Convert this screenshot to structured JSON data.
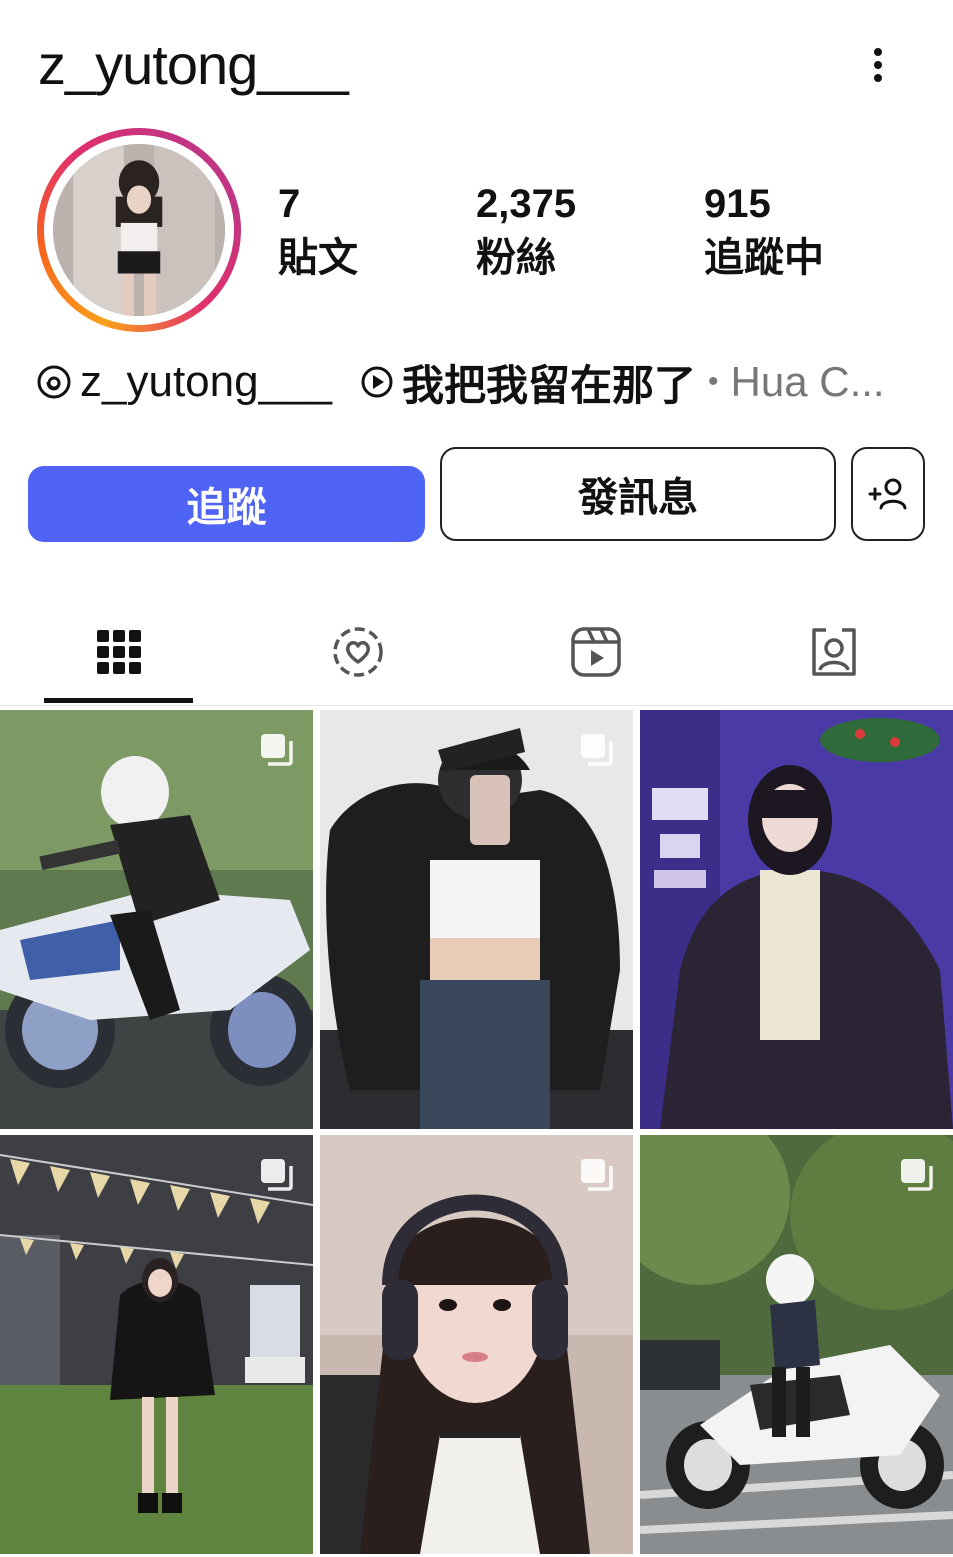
{
  "profile": {
    "username": "z_yutong___",
    "stats": [
      {
        "value": "7",
        "label": "貼文"
      },
      {
        "value": "2,375",
        "label": "粉絲"
      },
      {
        "value": "915",
        "label": "追蹤中"
      }
    ],
    "threads_handle": "z_yutong___",
    "song_title": "我把我留在那了",
    "song_separator": "•",
    "song_artist": "Hua C..."
  },
  "actions": {
    "follow_label": "追蹤",
    "message_label": "發訊息",
    "add_user_icon": "add-user-icon"
  },
  "tabs": [
    {
      "icon": "grid-icon",
      "active": true
    },
    {
      "icon": "highlights-heart-icon",
      "active": false
    },
    {
      "icon": "reels-icon",
      "active": false
    },
    {
      "icon": "tagged-icon",
      "active": false
    }
  ],
  "posts": [
    {
      "desc": "motorcycle-rider-blurred",
      "multi": true
    },
    {
      "desc": "mirror-selfie-leather-jacket",
      "multi": true
    },
    {
      "desc": "purple-light-leather-jacket",
      "multi": false
    },
    {
      "desc": "courtyard-bunting-puffer-jacket",
      "multi": true
    },
    {
      "desc": "headphones-selfie",
      "multi": true
    },
    {
      "desc": "white-motorcycle-park",
      "multi": true
    }
  ],
  "colors": {
    "follow_button": "#4f63f5",
    "ring_gradient": [
      "#f9a01b",
      "#e1306c",
      "#c13584"
    ],
    "secondary_text": "#777777"
  }
}
